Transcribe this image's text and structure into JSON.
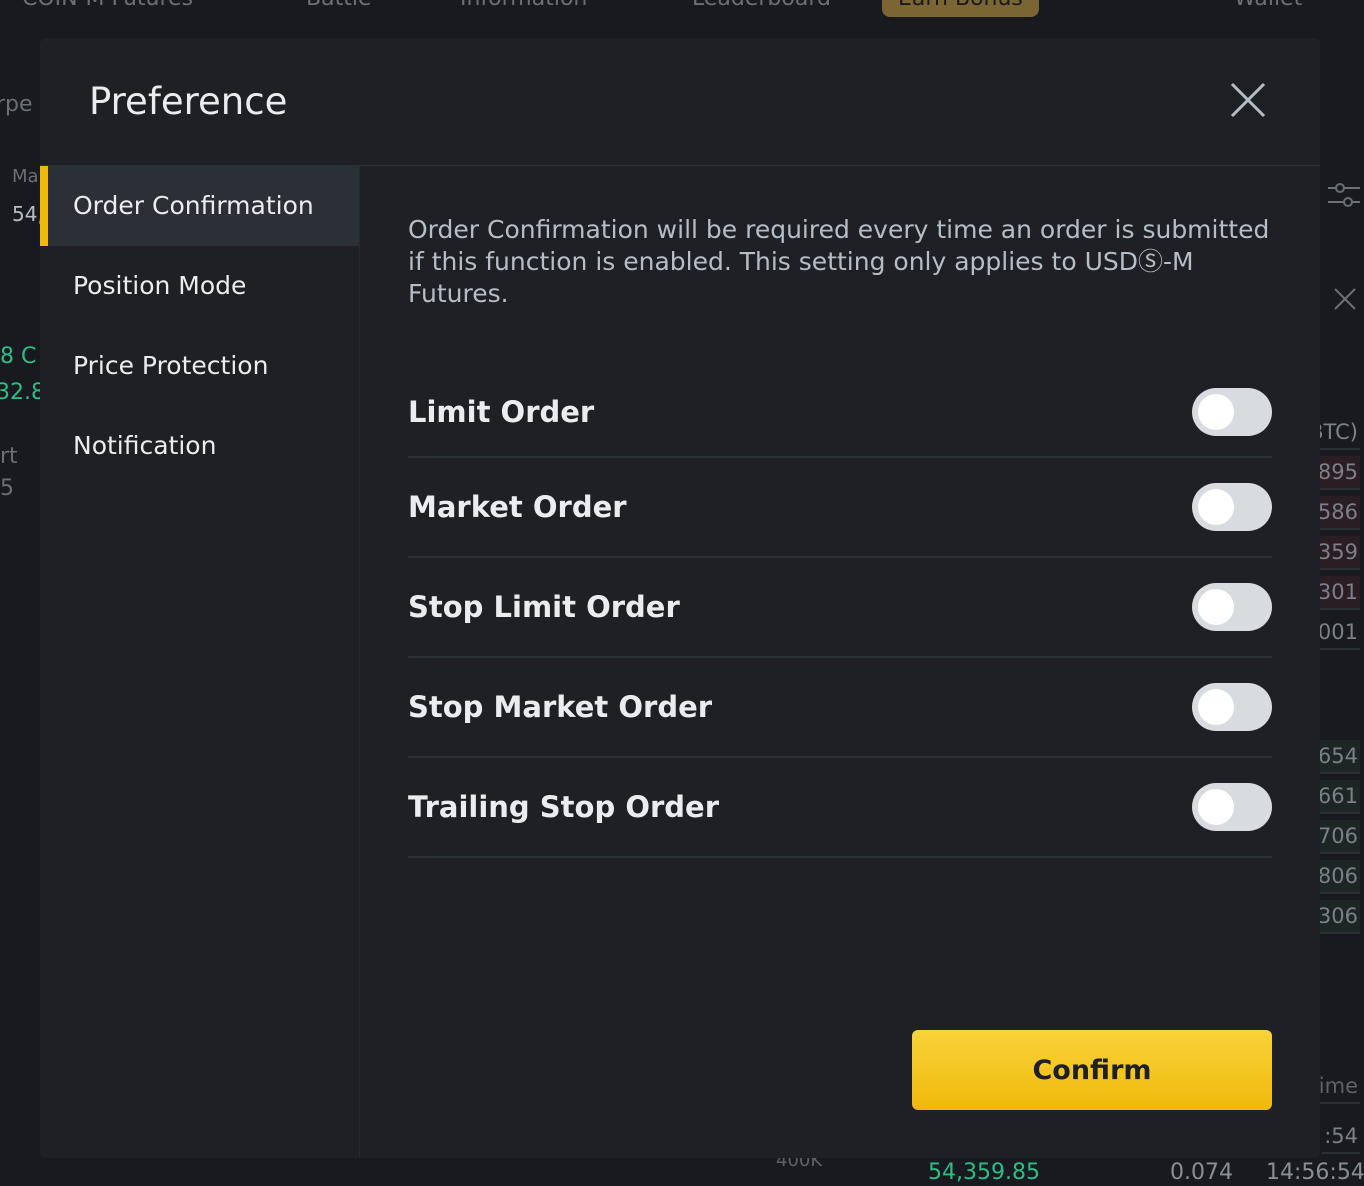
{
  "background": {
    "nav": [
      "COIN-M Futures",
      "Battle",
      "Information",
      "Leaderboard",
      "Earn Bonus",
      "Wallet"
    ],
    "right_values": [
      "BTC)",
      "895",
      "586",
      "359",
      "301",
      "001",
      "654",
      "661",
      "706",
      "806",
      "306"
    ],
    "left_text": [
      "rpe",
      "Ma",
      "54,",
      "8 C",
      "32.8",
      "rt",
      "5"
    ],
    "bottom": {
      "axis": "400K",
      "price": "54,359.85",
      "amount": "0.074",
      "time": "14:56:54",
      "time_partial": ":54",
      "label_partial": "ime"
    }
  },
  "modal": {
    "title": "Preference",
    "close_icon": "close-icon",
    "sidebar": [
      {
        "label": "Order Confirmation",
        "active": true
      },
      {
        "label": "Position Mode",
        "active": false
      },
      {
        "label": "Price Protection",
        "active": false
      },
      {
        "label": "Notification",
        "active": false
      }
    ],
    "description": "Order Confirmation will be required every time an order is submitted if this function is enabled. This setting only applies to USDⓈ-M Futures.",
    "options": [
      {
        "label": "Limit Order",
        "enabled": false
      },
      {
        "label": "Market Order",
        "enabled": false
      },
      {
        "label": "Stop Limit Order",
        "enabled": false
      },
      {
        "label": "Stop Market Order",
        "enabled": false
      },
      {
        "label": "Trailing Stop Order",
        "enabled": false
      }
    ],
    "confirm_label": "Confirm"
  },
  "colors": {
    "accent": "#f0b90b",
    "background": "#1e2026",
    "toggle_off": "#d8dbe0"
  }
}
